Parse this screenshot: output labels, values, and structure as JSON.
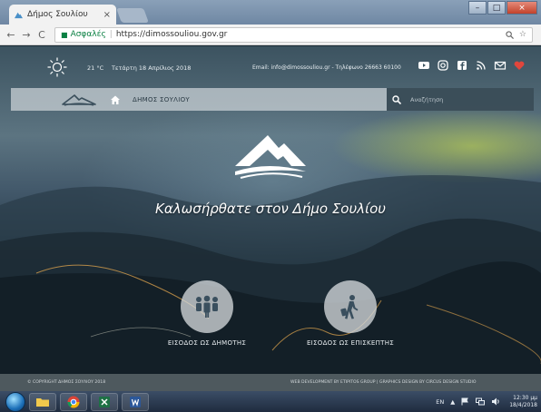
{
  "browser": {
    "tab_title": "Δήμος Σουλίου",
    "tab_close": "×",
    "back": "←",
    "forward": "→",
    "reload": "C",
    "secure_label": "Ασφαλές",
    "separator": "|",
    "url": "https://dimossouliou.gov.gr",
    "window_controls": {
      "minimize": "–",
      "maximize": "□",
      "close": "×"
    }
  },
  "topbar": {
    "temperature": "21 °C",
    "date": "Τετάρτη 18 Απρίλιος 2018",
    "contact": "Email: info@dimossouliou.gr - Τηλέφωνο 26663 60100"
  },
  "menubar": {
    "title": "ΔΗΜΟΣ ΣΟΥΛΙΟΥ",
    "search_placeholder": "Αναζήτηση"
  },
  "hero": {
    "welcome": "Καλωσήρθατε στον Δήμο Σουλίου"
  },
  "entries": {
    "citizen_label": "ΕΙΣΟΔΟΣ ΩΣ ΔΗΜΟΤΗΣ",
    "visitor_label": "ΕΙΣΟΔΟΣ ΩΣ ΕΠΙΣΚΕΠΤΗΣ"
  },
  "footer": {
    "copyright": "© COPYRIGHT ΔΗΜΟΣ ΣΟΥΛΙΟΥ 2018",
    "credits": "WEB DEVELOPMENT BY ETIPITOS GROUP | GRAPHICS DESIGN BY CIRCUS DESIGN STUDIO"
  },
  "taskbar": {
    "language": "EN",
    "tray_arrow": "▲",
    "time": "12:30 μμ",
    "date": "18/4/2018"
  },
  "colors": {
    "social_youtube": "#ffffff",
    "social_heart": "#e0463c",
    "accent_dark": "#283c48"
  }
}
